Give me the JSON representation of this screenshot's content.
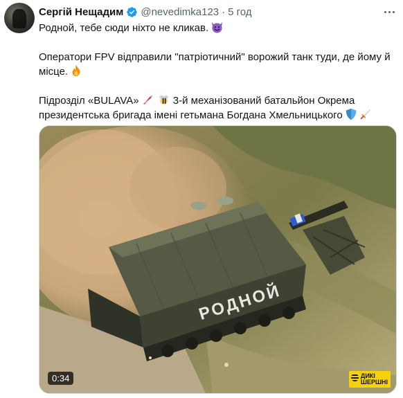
{
  "author": {
    "name": "Сергій Нещадим",
    "handle": "@nevedimka123",
    "separator": "·",
    "time": "5 год"
  },
  "tweet": {
    "line1": "Родной, тебе сюди ніхто не кликав.",
    "line2": "Оператори FPV відправили \"патріотичний\" ворожий танк туди, де йому й місце.",
    "line3a": "Підрозділ «BULAVA»",
    "line3b": "3-й механізований батальйон Окрема президентська бригада імені гетьмана Богдана Хмельницького"
  },
  "media": {
    "duration": "0:34",
    "watermark_line1": "ДИКІ",
    "watermark_line2": "ШЕРШНІ",
    "tank_marking": "РОДНОЙ"
  },
  "icons": {
    "verified": "verified-badge-icon",
    "more": "more-options-icon",
    "devil": "smiling-devil-emoji",
    "fire": "fire-emoji",
    "rocket": "rocket-emoji",
    "bee": "bee-emoji",
    "shield": "shield-emoji",
    "dagger": "dagger-emoji"
  },
  "colors": {
    "text": "#0f1419",
    "secondary": "#536471",
    "verified": "#1d9bf0"
  }
}
